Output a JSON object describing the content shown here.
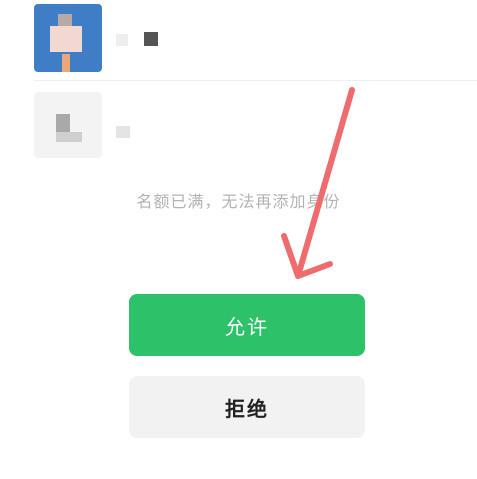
{
  "members": [
    {
      "avatar": "blurred-avatar-blue"
    },
    {
      "avatar": "blurred-avatar-grey"
    }
  ],
  "notice": "名额已满，无法再添加身份",
  "buttons": {
    "allow_label": "允许",
    "reject_label": "拒绝"
  },
  "colors": {
    "allow": "#2dc26a",
    "reject_bg": "#f2f2f2",
    "annotation_arrow": "#ee6b6e",
    "notice_text": "#b3b3b3"
  },
  "icons": [
    "annotation-arrow-icon"
  ]
}
